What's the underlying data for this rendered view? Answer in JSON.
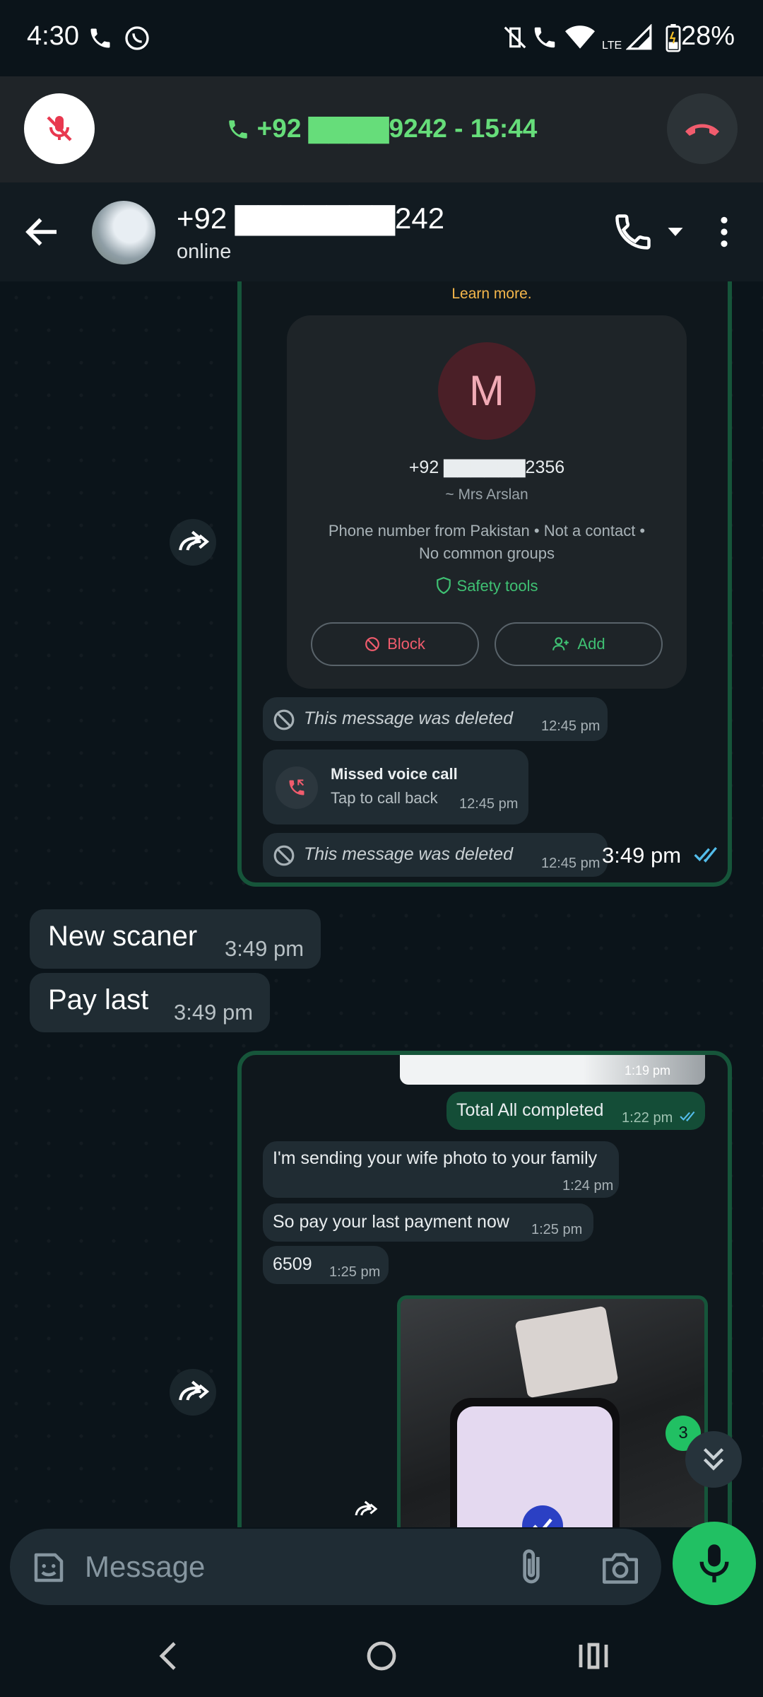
{
  "status_bar": {
    "time": "4:30",
    "battery": "28%",
    "network": "LTE"
  },
  "call_banner": {
    "number_call": "+92 ▇▇▇▇9242 - 15:44"
  },
  "header": {
    "contact_name": "+92 ▇▇▇▇▇▇▇242",
    "status": "online"
  },
  "forwarded_block_1": {
    "learn_more": "Learn more.",
    "card": {
      "avatar_letter": "M",
      "phone": "+92 ▇▇▇▇▇▇2356",
      "alias": "~ Mrs Arslan",
      "info_line1": "Phone number from Pakistan • Not a contact •",
      "info_line2": "No common groups",
      "safety": "Safety tools",
      "block": "Block",
      "add": "Add"
    },
    "deleted1": {
      "text": "This message was deleted",
      "time": "12:45 pm"
    },
    "missed": {
      "title": "Missed voice call",
      "sub": "Tap to call back",
      "time": "12:45 pm"
    },
    "deleted2": {
      "text": "This message was deleted",
      "time": "12:45 pm"
    },
    "outer_time": "3:49 pm"
  },
  "messages": [
    {
      "text": "New scaner",
      "time": "3:49 pm"
    },
    {
      "text": "Pay last",
      "time": "3:49 pm"
    }
  ],
  "forwarded_block_2": {
    "image_time": "1:19 pm",
    "out_msg": {
      "text": "Total All completed",
      "time": "1:22 pm"
    },
    "in1": {
      "text": "I'm sending your wife photo to your family",
      "time": "1:24 pm"
    },
    "in2": {
      "text": "So pay your last payment now",
      "time": "1:25 pm"
    },
    "in3": {
      "text": "6509",
      "time": "1:25 pm"
    },
    "unread_badge": "3"
  },
  "input": {
    "placeholder": "Message"
  },
  "colors": {
    "accent_green": "#21c063",
    "call_green": "#66dd7a",
    "danger": "#f15c6d",
    "frame": "#16553a"
  }
}
